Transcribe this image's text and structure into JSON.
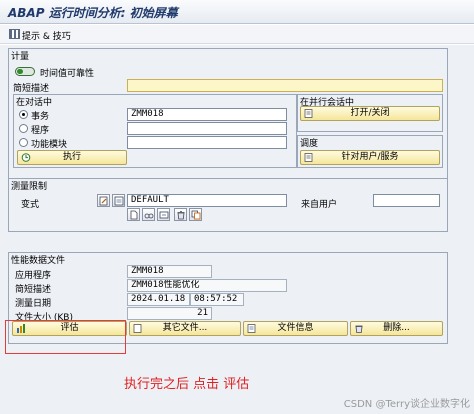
{
  "window": {
    "title": "ABAP 运行时间分析: 初始屏幕"
  },
  "toolbar": {
    "tips_label": "提示 & 技巧",
    "tips_icon": "tips-grid-icon"
  },
  "measurement": {
    "group_title": "计量",
    "time_reliability_label": "时间值可靠性",
    "short_desc_label": "简短描述",
    "short_desc_value": "",
    "in_dialog": {
      "title": "在对话中",
      "transaction_label": "事务",
      "transaction_value": "ZMM018",
      "program_label": "程序",
      "program_value": "",
      "function_module_label": "功能模块",
      "function_module_value": "",
      "execute_button": "执行"
    },
    "parallel_session": {
      "title": "在并行会话中",
      "switch_button": "打开/关闭"
    },
    "schedule": {
      "title": "调度",
      "for_user_button": "针对用户/服务"
    }
  },
  "restrictions": {
    "group_title": "测量限制",
    "variant_label": "变式",
    "variant_value": "DEFAULT",
    "from_user_label": "来自用户",
    "from_user_value": ""
  },
  "performance_file": {
    "group_title": "性能数据文件",
    "application_label": "应用程序",
    "application_value": "ZMM018",
    "short_desc_label": "简短描述",
    "short_desc_value": "ZMM018性能优化",
    "date_label": "测量日期",
    "date_value": "2024.01.18",
    "time_value": "08:57:52",
    "size_label": "文件大小 (KB)",
    "size_value": "21",
    "evaluate_button": "评估",
    "other_file_button": "其它文件...",
    "file_info_button": "文件信息",
    "delete_button": "删除..."
  },
  "annotation": {
    "text": "执行完之后 点击 评估"
  },
  "watermark": {
    "text": "CSDN @Terry谈企业数字化"
  },
  "colors": {
    "required_field": "#fdf6c9",
    "button": "#f5e69a",
    "annotation": "#e02020"
  }
}
